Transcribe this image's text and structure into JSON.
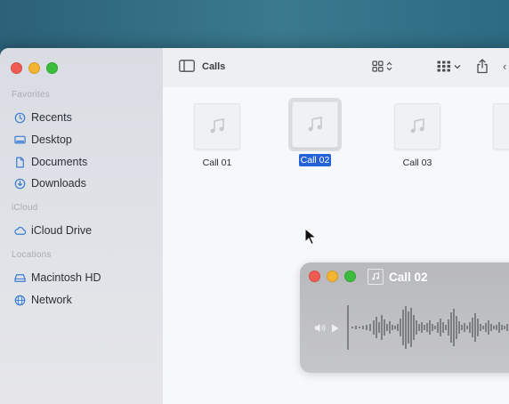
{
  "sidebar": {
    "sections": [
      {
        "title": "Favorites",
        "items": [
          "Recents",
          "Desktop",
          "Documents",
          "Downloads"
        ]
      },
      {
        "title": "iCloud",
        "items": [
          "iCloud Drive"
        ]
      },
      {
        "title": "Locations",
        "items": [
          "Macintosh HD",
          "Network"
        ]
      }
    ]
  },
  "toolbar": {
    "title": "Calls"
  },
  "files": [
    {
      "name": "Call 01",
      "selected": false
    },
    {
      "name": "Call 02",
      "selected": true
    },
    {
      "name": "Call 03",
      "selected": false
    },
    {
      "name": "Ca",
      "selected": false
    }
  ],
  "player": {
    "title": "Call 02"
  },
  "colors": {
    "accent": "#2362d8",
    "icon": "#3a7bd5"
  }
}
